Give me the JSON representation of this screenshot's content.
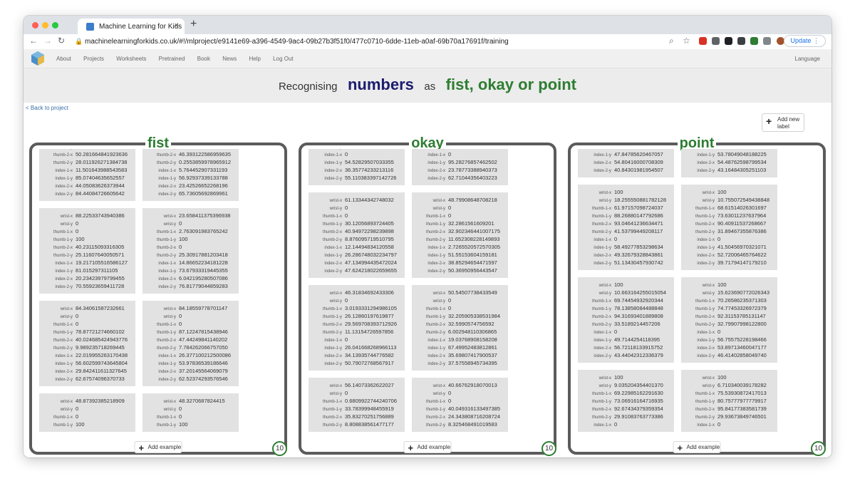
{
  "browser": {
    "tab_title": "Machine Learning for Kids",
    "tab_close": "×",
    "new_tab": "+",
    "url": "machinelearningforkids.co.uk/#!/mlproject/e9141e69-a396-4549-9ac4-09b27b3f51f0/477c0710-6dde-11eb-a0af-69b70a17691f/training",
    "update_label": "Update"
  },
  "nav": {
    "items": [
      "About",
      "Projects",
      "Worksheets",
      "Pretrained",
      "Book",
      "News",
      "Help",
      "Log Out"
    ],
    "language": "Language"
  },
  "title": {
    "prefix": "Recognising",
    "type": "numbers",
    "middle": "as",
    "labels": "fist, okay or point"
  },
  "back_link": "< Back to project",
  "add_label_button": "Add new label",
  "add_example_label": "Add example",
  "buckets": [
    {
      "name": "fist",
      "count": "10",
      "columns": [
        [
          [
            [
              "thumb-1-y",
              "…"
            ],
            [
              "thumb-2-x",
              "50.281664841923636"
            ],
            [
              "thumb-2-y",
              "28.011926271384738"
            ],
            [
              "index-1-x",
              "11.501643988543583"
            ],
            [
              "index-1-y",
              "85.07404635652557"
            ],
            [
              "index-2-x",
              "44.05083626373944"
            ],
            [
              "index-2-y",
              "84.44084726605642"
            ]
          ],
          [
            [
              "wrist-x",
              "88.22533743940386"
            ],
            [
              "wrist-y",
              "0"
            ],
            [
              "thumb-1-x",
              "0"
            ],
            [
              "thumb-1-y",
              "100"
            ],
            [
              "thumb-2-x",
              "40.23115093316305"
            ],
            [
              "thumb-2-y",
              "25.11607640050571"
            ],
            [
              "index-1-x",
              "19.217105516586127"
            ],
            [
              "index-1-y",
              "81.015297311105"
            ],
            [
              "index-2-x",
              "20.23423979799455"
            ],
            [
              "index-2-y",
              "70.55923659411728"
            ]
          ],
          [
            [
              "wrist-x",
              "84.34061587232661"
            ],
            [
              "wrist-y",
              "0"
            ],
            [
              "thumb-1-x",
              "0"
            ],
            [
              "thumb-1-y",
              "78.87721274660102"
            ],
            [
              "thumb-2-x",
              "40.024685424943776"
            ],
            [
              "thumb-2-y",
              "9.989235718269445"
            ],
            [
              "index-1-x",
              "22.019955263170438"
            ],
            [
              "index-1-y",
              "56.602599743645804"
            ],
            [
              "index-2-x",
              "29.842411611327645"
            ],
            [
              "index-2-y",
              "62.67574096370733"
            ]
          ],
          [
            [
              "wrist-x",
              "48.87392385218909"
            ],
            [
              "wrist-y",
              "0"
            ],
            [
              "thumb-1-x",
              "0"
            ],
            [
              "thumb-1-y",
              "100"
            ]
          ]
        ],
        [
          [
            [
              "thumb-1-y",
              "…"
            ],
            [
              "thumb-2-x",
              "46.393122586959635"
            ],
            [
              "thumb-2-y",
              "0.2553859978965912"
            ],
            [
              "index-1-x",
              "5.764452907331193"
            ],
            [
              "index-1-y",
              "56.92937339133788"
            ],
            [
              "index-2-x",
              "23.42526652268196"
            ],
            [
              "index-2-y",
              "65.73605692869961"
            ]
          ],
          [
            [
              "wrist-x",
              "23.658411375396938"
            ],
            [
              "wrist-y",
              "0"
            ],
            [
              "thumb-1-x",
              "2.763091983765242"
            ],
            [
              "thumb-1-y",
              "100"
            ],
            [
              "thumb-2-x",
              "0"
            ],
            [
              "thumb-2-y",
              "25.30917881203418"
            ],
            [
              "index-1-x",
              "14.86652234181228"
            ],
            [
              "index-1-y",
              "73.67933319445355"
            ],
            [
              "index-2-x",
              "6.042195280507086"
            ],
            [
              "index-2-y",
              "76.81779044859283"
            ]
          ],
          [
            [
              "wrist-x",
              "84.18559778701147"
            ],
            [
              "wrist-y",
              "0"
            ],
            [
              "thumb-1-x",
              "0"
            ],
            [
              "thumb-1-y",
              "87.12247815438946"
            ],
            [
              "thumb-2-x",
              "47.44249841140202"
            ],
            [
              "thumb-2-y",
              "7.784262066757050"
            ],
            [
              "index-1-x",
              "26.377100212500086"
            ],
            [
              "index-1-y",
              "53.97836539186646"
            ],
            [
              "index-2-x",
              "37.20145564069079"
            ],
            [
              "index-2-y",
              "62.52374293576546"
            ]
          ],
          [
            [
              "wrist-x",
              "48.3270687824415"
            ],
            [
              "wrist-y",
              "0"
            ],
            [
              "thumb-1-x",
              "0"
            ],
            [
              "thumb-1-y",
              "100"
            ]
          ]
        ]
      ]
    },
    {
      "name": "okay",
      "count": "10",
      "columns": [
        [
          [
            [
              "wrist-y",
              "…"
            ],
            [
              "index-1-x",
              "0"
            ],
            [
              "index-1-y",
              "54.52829507033355"
            ],
            [
              "index-2-x",
              "36.35774233213116"
            ],
            [
              "index-2-y",
              "55.110383397142726"
            ]
          ],
          [
            [
              "wrist-x",
              "61.13344342748032"
            ],
            [
              "wrist-y",
              "0"
            ],
            [
              "thumb-1-x",
              "0"
            ],
            [
              "thumb-1-y",
              "30.12056893724405"
            ],
            [
              "thumb-2-x",
              "40.94972298239898"
            ],
            [
              "thumb-2-y",
              "8.876095719510795"
            ],
            [
              "index-1-x",
              "12.14494834120558"
            ],
            [
              "index-1-y",
              "26.286748032234797"
            ],
            [
              "index-2-x",
              "47.134994435472024"
            ],
            [
              "index-2-y",
              "47.624218022659655"
            ]
          ],
          [
            [
              "wrist-x",
              "46.31834692433306"
            ],
            [
              "wrist-y",
              "0"
            ],
            [
              "thumb-1-x",
              "3.0193331294986105"
            ],
            [
              "thumb-1-y",
              "26.12860197619877"
            ],
            [
              "thumb-2-x",
              "29.569708393712926"
            ],
            [
              "thumb-2-y",
              "11.13154726597856"
            ],
            [
              "index-1-x",
              "0"
            ],
            [
              "index-1-y",
              "26.041668268966113"
            ],
            [
              "index-2-x",
              "34.13935744776582"
            ],
            [
              "index-2-y",
              "50.79072768567917"
            ]
          ],
          [
            [
              "wrist-x",
              "56.14073362622027"
            ],
            [
              "wrist-y",
              "0"
            ],
            [
              "thumb-1-x",
              "0.6809922744240706"
            ],
            [
              "thumb-1-y",
              "33.78399948455919"
            ],
            [
              "thumb-2-x",
              "35.83270251756889"
            ],
            [
              "thumb-2-y",
              "8.808838561477177"
            ]
          ]
        ],
        [
          [
            [
              "wrist-y",
              "…"
            ],
            [
              "index-1-x",
              "0"
            ],
            [
              "index-1-y",
              "95.28276857462502"
            ],
            [
              "index-2-x",
              "23.78773388940373"
            ],
            [
              "index-2-y",
              "62.71044356403223"
            ]
          ],
          [
            [
              "wrist-x",
              "48.79908648708218"
            ],
            [
              "wrist-y",
              "0"
            ],
            [
              "thumb-1-x",
              "0"
            ],
            [
              "thumb-1-y",
              "32.2861561609201"
            ],
            [
              "thumb-2-x",
              "32.902346441007175"
            ],
            [
              "thumb-2-y",
              "11.652308228149893"
            ],
            [
              "index-1-x",
              "2.7265520572570305"
            ],
            [
              "index-1-y",
              "51.55153604159181"
            ],
            [
              "index-2-x",
              "38.85294654471597"
            ],
            [
              "index-2-y",
              "50.36950956443547"
            ]
          ],
          [
            [
              "wrist-x",
              "50.54507738433549"
            ],
            [
              "wrist-y",
              "0"
            ],
            [
              "thumb-1-x",
              "0"
            ],
            [
              "thumb-1-y",
              "32.205905338531984"
            ],
            [
              "thumb-2-x",
              "32.5990574756592"
            ],
            [
              "thumb-2-y",
              "6.002948110306865"
            ],
            [
              "index-1-x",
              "19.03768908158208"
            ],
            [
              "index-1-y",
              "67.49952483812861"
            ],
            [
              "index-2-x",
              "35.69807417900537"
            ],
            [
              "index-2-y",
              "37.57558945734395"
            ]
          ],
          [
            [
              "wrist-x",
              "40.66762918070013"
            ],
            [
              "wrist-y",
              "0"
            ],
            [
              "thumb-1-x",
              "0"
            ],
            [
              "thumb-1-y",
              "40.049316133497385"
            ],
            [
              "thumb-2-x",
              "24.343808716208724"
            ],
            [
              "thumb-2-y",
              "8.325468491019583"
            ]
          ]
        ]
      ]
    },
    {
      "name": "point",
      "count": "10",
      "columns": [
        [
          [
            [
              "index-1-x",
              "0"
            ],
            [
              "index-1-y",
              "47.84785620467057"
            ],
            [
              "index-2-x",
              "54.80416000708309"
            ],
            [
              "index-2-y",
              "40.84301981954507"
            ]
          ],
          [
            [
              "wrist-x",
              "100"
            ],
            [
              "wrist-y",
              "18.255550881782128"
            ],
            [
              "thumb-1-x",
              "61.97157098724037"
            ],
            [
              "thumb-1-y",
              "88.26880147792686"
            ],
            [
              "thumb-2-x",
              "93.04641236634471"
            ],
            [
              "thumb-2-y",
              "41.53799449208117"
            ],
            [
              "index-1-x",
              "0"
            ],
            [
              "index-1-y",
              "58.49277853298634"
            ],
            [
              "index-2-x",
              "49.32679328843861"
            ],
            [
              "index-2-y",
              "51.13430457930742"
            ]
          ],
          [
            [
              "wrist-x",
              "100"
            ],
            [
              "wrist-y",
              "10.663164255015054"
            ],
            [
              "thumb-1-x",
              "69.74454932920344"
            ],
            [
              "thumb-1-y",
              "78.13858084488848"
            ],
            [
              "thumb-2-x",
              "94.31693401889808"
            ],
            [
              "thumb-2-y",
              "33.5189214457206"
            ],
            [
              "index-1-x",
              "0"
            ],
            [
              "index-1-y",
              "49.7144254118395"
            ],
            [
              "index-2-x",
              "56.72118133915752"
            ],
            [
              "index-2-y",
              "43.44042312336379"
            ]
          ],
          [
            [
              "wrist-x",
              "100"
            ],
            [
              "wrist-y",
              "9.035204354401370"
            ],
            [
              "thumb-1-x",
              "69.22985162291630"
            ],
            [
              "thumb-1-y",
              "73.06916164716935"
            ],
            [
              "thumb-2-x",
              "92.67434379359354"
            ],
            [
              "thumb-2-y",
              "29.91083763773386"
            ],
            [
              "index-1-x",
              "0"
            ]
          ]
        ],
        [
          [
            [
              "index-1-x",
              "0"
            ],
            [
              "index-1-y",
              "53.78049048188225"
            ],
            [
              "index-2-x",
              "54.48762598799534"
            ],
            [
              "index-2-y",
              "43.16484305251103"
            ]
          ],
          [
            [
              "wrist-x",
              "100"
            ],
            [
              "wrist-y",
              "10.755072549438848"
            ],
            [
              "thumb-1-x",
              "68.61514026301697"
            ],
            [
              "thumb-1-y",
              "73.63011237637964"
            ],
            [
              "thumb-2-x",
              "90.40911537268667"
            ],
            [
              "thumb-2-y",
              "31.89467355876386"
            ],
            [
              "index-1-x",
              "0"
            ],
            [
              "index-1-y",
              "41.50456970321071"
            ],
            [
              "index-2-x",
              "52.72006465764622"
            ],
            [
              "index-2-y",
              "39.71794147179210"
            ]
          ],
          [
            [
              "wrist-x",
              "100"
            ],
            [
              "wrist-y",
              "15.623690772026343"
            ],
            [
              "thumb-1-x",
              "70.26586235371303"
            ],
            [
              "thumb-1-y",
              "74.77453326972379"
            ],
            [
              "thumb-2-x",
              "92.31153785131147"
            ],
            [
              "thumb-2-y",
              "32.79907998122800"
            ],
            [
              "index-1-x",
              "0"
            ],
            [
              "index-1-y",
              "56.75575228198466"
            ],
            [
              "index-2-x",
              "53.89713460047177"
            ],
            [
              "index-2-y",
              "46.41402858049740"
            ]
          ],
          [
            [
              "wrist-x",
              "100"
            ],
            [
              "wrist-y",
              "6.710340039178282"
            ],
            [
              "thumb-1-x",
              "75.53930872417013"
            ],
            [
              "thumb-1-y",
              "80.75777977779917"
            ],
            [
              "thumb-2-x",
              "95.84177383581739"
            ],
            [
              "thumb-2-y",
              "29.93673849746501"
            ],
            [
              "index-1-x",
              "0"
            ]
          ]
        ]
      ]
    }
  ]
}
